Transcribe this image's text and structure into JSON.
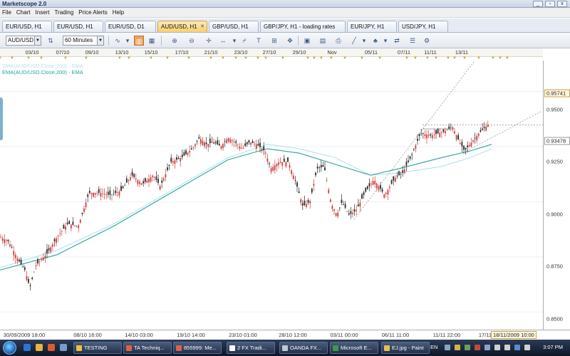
{
  "window": {
    "title": "Marketscope 2.0",
    "controls": [
      "_",
      "▫",
      "x"
    ]
  },
  "menu": [
    "File",
    "Chart",
    "Insert",
    "Trading",
    "Price Alerts",
    "Help"
  ],
  "tabs": [
    {
      "label": "EUR/USD, H1",
      "active": false
    },
    {
      "label": "EUR/USD, H1",
      "active": false
    },
    {
      "label": "EUR/USD, D1",
      "active": false
    },
    {
      "label": "AUD/USD, H1",
      "active": true
    },
    {
      "label": "GBP/USD, H1",
      "active": false
    },
    {
      "label": "GBP/JPY, H1  - loading rates",
      "active": false
    },
    {
      "label": "EUR/JPY, H1",
      "active": false
    },
    {
      "label": "USD/JPY, H1",
      "active": false
    }
  ],
  "toolbar": {
    "instrument": "AUD/USD",
    "timeframe": "60 Minutes"
  },
  "date_strip": [
    "03/10",
    "07/10",
    "09/10",
    "13/10",
    "15/10",
    "17/10",
    "21/10",
    "23/10",
    "27/10",
    "29/10",
    "Nov",
    "05/11",
    "07/11",
    "11/11",
    "13/11"
  ],
  "legend": {
    "line1": "SMA(AUD/USD.Close,200) - SMA",
    "line2": "EMA(AUD/USD.Close,200) - EMA"
  },
  "price_axis": {
    "labels": [
      "0.9500",
      "0.9250",
      "0.9000",
      "0.8750",
      "0.8500"
    ],
    "high_tag": "0.95741",
    "current_tag": "0.93478"
  },
  "time_axis": {
    "labels": [
      "30/09/2009 18:00",
      "08/10 16:00",
      "14/10 03:00",
      "19/10 14:00",
      "23/10 01:00",
      "28/10 12:00",
      "03/11 00:00",
      "06/11 11:00",
      "11/11 22:00",
      "17/11"
    ],
    "cursor_tag": "18/11/2009 10:00"
  },
  "taskbar": {
    "items": [
      "TESTING",
      "TA Techniq...",
      "855999: Me...",
      "2 FX Tradi...",
      "OANDA FX...",
      "Microsoft E...",
      "EJ.jpg - Paint"
    ],
    "language": "EN",
    "clock": "3:07 PM"
  },
  "chart_data": {
    "type": "candlestick",
    "instrument": "AUD/USD",
    "timeframe": "H1",
    "ylim": [
      0.842,
      0.964
    ],
    "y_ticks": [
      0.85,
      0.875,
      0.9,
      0.925,
      0.95
    ],
    "key_levels": {
      "high_marker": 0.95741,
      "current_price": 0.93478
    },
    "price_path": [
      [
        0,
        0.884
      ],
      [
        12,
        0.882
      ],
      [
        25,
        0.874
      ],
      [
        35,
        0.869
      ],
      [
        42,
        0.861
      ],
      [
        50,
        0.871
      ],
      [
        65,
        0.876
      ],
      [
        80,
        0.884
      ],
      [
        95,
        0.89
      ],
      [
        110,
        0.889
      ],
      [
        125,
        0.904
      ],
      [
        140,
        0.904
      ],
      [
        155,
        0.903
      ],
      [
        170,
        0.905
      ],
      [
        185,
        0.912
      ],
      [
        200,
        0.908
      ],
      [
        215,
        0.912
      ],
      [
        225,
        0.907
      ],
      [
        240,
        0.918
      ],
      [
        255,
        0.92
      ],
      [
        270,
        0.924
      ],
      [
        280,
        0.929
      ],
      [
        290,
        0.926
      ],
      [
        300,
        0.927
      ],
      [
        310,
        0.925
      ],
      [
        320,
        0.929
      ],
      [
        330,
        0.927
      ],
      [
        340,
        0.924
      ],
      [
        350,
        0.927
      ],
      [
        360,
        0.926
      ],
      [
        372,
        0.923
      ],
      [
        380,
        0.915
      ],
      [
        392,
        0.918
      ],
      [
        405,
        0.918
      ],
      [
        415,
        0.909
      ],
      [
        425,
        0.898
      ],
      [
        435,
        0.9
      ],
      [
        445,
        0.915
      ],
      [
        455,
        0.916
      ],
      [
        465,
        0.899
      ],
      [
        473,
        0.894
      ],
      [
        480,
        0.9
      ],
      [
        490,
        0.894
      ],
      [
        500,
        0.896
      ],
      [
        512,
        0.904
      ],
      [
        525,
        0.91
      ],
      [
        540,
        0.903
      ],
      [
        555,
        0.911
      ],
      [
        565,
        0.913
      ],
      [
        578,
        0.921
      ],
      [
        590,
        0.931
      ],
      [
        605,
        0.93
      ],
      [
        615,
        0.931
      ],
      [
        625,
        0.932
      ],
      [
        635,
        0.934
      ],
      [
        645,
        0.927
      ],
      [
        652,
        0.923
      ],
      [
        662,
        0.927
      ],
      [
        672,
        0.931
      ],
      [
        685,
        0.935
      ]
    ],
    "series": [
      {
        "name": "SMA(AUD/USD.Close,200) - SMA",
        "color": "#aadfe6",
        "path": [
          [
            0,
            0.87
          ],
          [
            80,
            0.878
          ],
          [
            160,
            0.89
          ],
          [
            240,
            0.905
          ],
          [
            320,
            0.92
          ],
          [
            375,
            0.926
          ],
          [
            420,
            0.924
          ],
          [
            470,
            0.92
          ],
          [
            520,
            0.912
          ],
          [
            560,
            0.913
          ],
          [
            620,
            0.916
          ],
          [
            660,
            0.92
          ],
          [
            690,
            0.924
          ]
        ]
      },
      {
        "name": "EMA(AUD/USD.Close,200) - EMA",
        "color": "#2aa39a",
        "path": [
          [
            0,
            0.869
          ],
          [
            80,
            0.876
          ],
          [
            160,
            0.889
          ],
          [
            240,
            0.904
          ],
          [
            320,
            0.919
          ],
          [
            375,
            0.924
          ],
          [
            420,
            0.922
          ],
          [
            470,
            0.917
          ],
          [
            520,
            0.912
          ],
          [
            560,
            0.915
          ],
          [
            620,
            0.92
          ],
          [
            660,
            0.923
          ],
          [
            690,
            0.926
          ]
        ]
      }
    ],
    "drawings": [
      {
        "kind": "trendline",
        "from": [
          497,
          0.892
        ],
        "to": [
          690,
          0.974
        ]
      },
      {
        "kind": "trendline",
        "from": [
          655,
          0.923
        ],
        "to": [
          760,
          0.941
        ]
      },
      {
        "kind": "hline",
        "value": 0.93478
      },
      {
        "kind": "segment",
        "from": [
          593,
          0.933
        ],
        "to": [
          632,
          0.933
        ]
      }
    ]
  }
}
